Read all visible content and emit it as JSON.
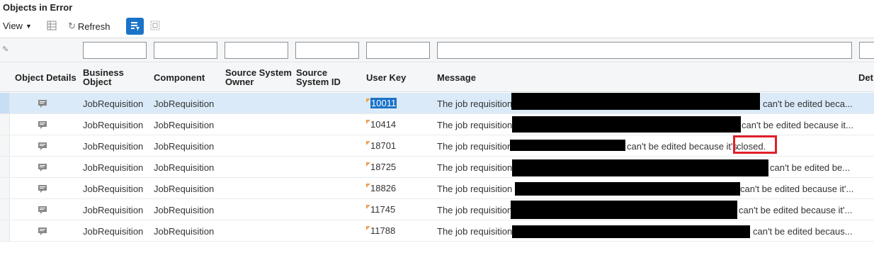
{
  "page": {
    "title": "Objects in Error"
  },
  "toolbar": {
    "view_label": "View",
    "refresh_label": "Refresh"
  },
  "columns": {
    "object_details": "Object Details",
    "business_object": "Business Object",
    "component": "Component",
    "source_system_owner": "Source System Owner",
    "source_system_id": "Source System ID",
    "user_key": "User Key",
    "message": "Message",
    "details_partial": "Det"
  },
  "rows": [
    {
      "business_object": "JobRequisition",
      "component": "JobRequisition",
      "user_key": "10011",
      "message_prefix": "The job requisition",
      "message_suffix": "can't be edited beca...",
      "selected": true
    },
    {
      "business_object": "JobRequisition",
      "component": "JobRequisition",
      "user_key": "10414",
      "message_prefix": "The job requisition",
      "message_suffix": "can't be edited because it...",
      "selected": false
    },
    {
      "business_object": "JobRequisition",
      "component": "JobRequisition",
      "user_key": "18701",
      "message_prefix": "The job requisition",
      "message_suffix": "can't be edited because it's",
      "message_end": "closed.",
      "selected": false
    },
    {
      "business_object": "JobRequisition",
      "component": "JobRequisition",
      "user_key": "18725",
      "message_prefix": "The job requisition",
      "message_suffix": "can't be edited be...",
      "selected": false
    },
    {
      "business_object": "JobRequisition",
      "component": "JobRequisition",
      "user_key": "18826",
      "message_prefix": "The job requisition",
      "message_suffix": "can't be edited because it'...",
      "selected": false
    },
    {
      "business_object": "JobRequisition",
      "component": "JobRequisition",
      "user_key": "11745",
      "message_prefix": "The job requisition",
      "message_suffix": "can't be edited because it'...",
      "selected": false
    },
    {
      "business_object": "JobRequisition",
      "component": "JobRequisition",
      "user_key": "11788",
      "message_prefix": "The job requisition",
      "message_suffix": "can't be edited becaus...",
      "selected": false
    }
  ],
  "colors": {
    "accent": "#1a73c8",
    "highlight_box": "#e0202a",
    "selected_row": "#dbeaf8"
  }
}
